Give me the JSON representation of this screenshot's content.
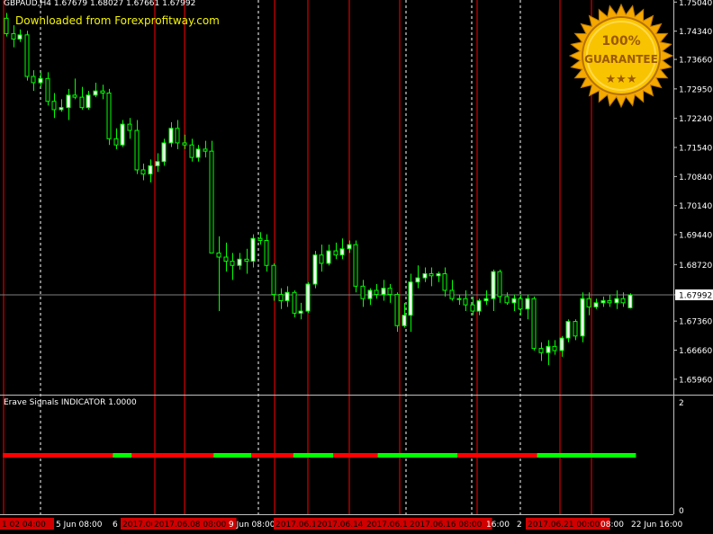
{
  "chart": {
    "symbol_line": "GBPAUD,H4  1.67679 1.68027 1.67661 1.67992",
    "download_text": "Downloaded from Forexprofitway.com",
    "badge_top": "100%",
    "badge_bottom": "GUARANTEE",
    "badge_stars": "★★★",
    "indicator_title": "Erave Signals INDICATOR 1.0000",
    "current_price": "1.67992",
    "colors": {
      "background": "#000000",
      "bull_candle": "#ffffff",
      "bear_candle": "#000000",
      "wick": "#00ff00",
      "session_line": "#ff0000",
      "grid_line": "#ffffff",
      "signal_buy": "#00ff00",
      "signal_sell": "#ff0000",
      "badge_gold": "#f0b000"
    }
  },
  "chart_data": {
    "type": "candlestick",
    "price_axis": {
      "ylim": [
        1.6561,
        1.7509
      ],
      "ticks": [
        "1.75040",
        "1.74340",
        "1.73660",
        "1.72950",
        "1.72240",
        "1.71540",
        "1.70840",
        "1.70140",
        "1.69440",
        "1.68720",
        "1.67992",
        "1.67360",
        "1.66660",
        "1.65960"
      ]
    },
    "indicator_axis": {
      "ylim": [
        0,
        2
      ],
      "ticks": [
        "2",
        "0"
      ]
    },
    "time_labels": [
      {
        "text": "1 02 04:00",
        "highlight": true
      },
      {
        "text": "5 Jun 08:00",
        "highlight": false
      },
      {
        "text": "6",
        "highlight": false
      },
      {
        "text": "2017.06",
        "highlight": true
      },
      {
        "text": "2017.06.08 08:00",
        "highlight": true
      },
      {
        "text": "9 Jun 08:00",
        "highlight": false
      },
      {
        "text": "2017.06.1",
        "highlight": true
      },
      {
        "text": "2017.06.14 0",
        "highlight": true
      },
      {
        "text": "2017.06.1",
        "highlight": true
      },
      {
        "text": "2017.06.16 08:00",
        "highlight": true
      },
      {
        "text": "16:00",
        "highlight": false
      },
      {
        "text": "2",
        "highlight": false
      },
      {
        "text": "2017.06.21 00:00",
        "highlight": true
      },
      {
        "text": "08:00",
        "highlight": false
      },
      {
        "text": "22 Jun 16:00",
        "highlight": false
      }
    ],
    "candles": [
      [
        1.7465,
        1.7478,
        1.7421,
        1.7428
      ],
      [
        1.7428,
        1.7448,
        1.7395,
        1.7415
      ],
      [
        1.7415,
        1.7438,
        1.7408,
        1.7425
      ],
      [
        1.7425,
        1.7435,
        1.7315,
        1.7325
      ],
      [
        1.7325,
        1.734,
        1.729,
        1.731
      ],
      [
        1.731,
        1.7335,
        1.73,
        1.732
      ],
      [
        1.732,
        1.7335,
        1.7255,
        1.7265
      ],
      [
        1.7265,
        1.7285,
        1.7225,
        1.7245
      ],
      [
        1.7245,
        1.727,
        1.724,
        1.725
      ],
      [
        1.725,
        1.7295,
        1.722,
        1.728
      ],
      [
        1.728,
        1.732,
        1.727,
        1.7275
      ],
      [
        1.7275,
        1.73,
        1.7245,
        1.725
      ],
      [
        1.725,
        1.729,
        1.7245,
        1.728
      ],
      [
        1.728,
        1.731,
        1.7275,
        1.729
      ],
      [
        1.729,
        1.7305,
        1.727,
        1.7285
      ],
      [
        1.7285,
        1.7295,
        1.716,
        1.7175
      ],
      [
        1.7175,
        1.72,
        1.715,
        1.716
      ],
      [
        1.716,
        1.722,
        1.7155,
        1.721
      ],
      [
        1.721,
        1.7225,
        1.7175,
        1.7195
      ],
      [
        1.7195,
        1.722,
        1.709,
        1.71
      ],
      [
        1.71,
        1.7115,
        1.7075,
        1.709
      ],
      [
        1.709,
        1.7125,
        1.707,
        1.711
      ],
      [
        1.711,
        1.714,
        1.7095,
        1.712
      ],
      [
        1.712,
        1.7175,
        1.711,
        1.7165
      ],
      [
        1.7165,
        1.7215,
        1.7155,
        1.72
      ],
      [
        1.72,
        1.722,
        1.715,
        1.7165
      ],
      [
        1.7165,
        1.7185,
        1.715,
        1.716
      ],
      [
        1.716,
        1.7175,
        1.712,
        1.713
      ],
      [
        1.713,
        1.716,
        1.712,
        1.715
      ],
      [
        1.715,
        1.717,
        1.713,
        1.7145
      ],
      [
        1.7145,
        1.717,
        1.696,
        1.69
      ],
      [
        1.69,
        1.694,
        1.676,
        1.689
      ],
      [
        1.689,
        1.6925,
        1.6855,
        1.688
      ],
      [
        1.688,
        1.69,
        1.6835,
        1.687
      ],
      [
        1.687,
        1.69,
        1.686,
        1.6885
      ],
      [
        1.6885,
        1.691,
        1.685,
        1.688
      ],
      [
        1.688,
        1.6945,
        1.6865,
        1.6935
      ],
      [
        1.6935,
        1.695,
        1.692,
        1.693
      ],
      [
        1.693,
        1.6945,
        1.6855,
        1.687
      ],
      [
        1.687,
        1.6875,
        1.6785,
        1.68
      ],
      [
        1.68,
        1.6815,
        1.6765,
        1.6785
      ],
      [
        1.6785,
        1.682,
        1.677,
        1.6805
      ],
      [
        1.6805,
        1.681,
        1.6745,
        1.6755
      ],
      [
        1.6755,
        1.678,
        1.674,
        1.676
      ],
      [
        1.676,
        1.683,
        1.6755,
        1.6825
      ],
      [
        1.6825,
        1.6905,
        1.6815,
        1.6895
      ],
      [
        1.6895,
        1.692,
        1.6855,
        1.6875
      ],
      [
        1.6875,
        1.692,
        1.687,
        1.6905
      ],
      [
        1.6905,
        1.6925,
        1.6885,
        1.6895
      ],
      [
        1.6895,
        1.6935,
        1.6885,
        1.691
      ],
      [
        1.691,
        1.693,
        1.69,
        1.692
      ],
      [
        1.692,
        1.693,
        1.6805,
        1.682
      ],
      [
        1.682,
        1.6835,
        1.677,
        1.679
      ],
      [
        1.679,
        1.6815,
        1.6775,
        1.681
      ],
      [
        1.681,
        1.6825,
        1.679,
        1.68
      ],
      [
        1.68,
        1.6835,
        1.6785,
        1.6815
      ],
      [
        1.6815,
        1.6825,
        1.678,
        1.68
      ],
      [
        1.68,
        1.6805,
        1.671,
        1.6725
      ],
      [
        1.6725,
        1.678,
        1.672,
        1.675
      ],
      [
        1.675,
        1.685,
        1.671,
        1.683
      ],
      [
        1.683,
        1.687,
        1.6815,
        1.684
      ],
      [
        1.684,
        1.6865,
        1.683,
        1.685
      ],
      [
        1.685,
        1.6865,
        1.682,
        1.6845
      ],
      [
        1.6845,
        1.6855,
        1.683,
        1.685
      ],
      [
        1.685,
        1.6865,
        1.6795,
        1.681
      ],
      [
        1.681,
        1.6835,
        1.6785,
        1.679
      ],
      [
        1.679,
        1.68,
        1.6775,
        1.679
      ],
      [
        1.679,
        1.681,
        1.676,
        1.6775
      ],
      [
        1.6775,
        1.6795,
        1.675,
        1.676
      ],
      [
        1.676,
        1.679,
        1.675,
        1.6785
      ],
      [
        1.6785,
        1.681,
        1.6775,
        1.679
      ],
      [
        1.679,
        1.686,
        1.676,
        1.6855
      ],
      [
        1.6855,
        1.686,
        1.678,
        1.6795
      ],
      [
        1.6795,
        1.6805,
        1.6775,
        1.678
      ],
      [
        1.678,
        1.68,
        1.676,
        1.679
      ],
      [
        1.679,
        1.68,
        1.675,
        1.6765
      ],
      [
        1.6765,
        1.68,
        1.674,
        1.679
      ],
      [
        1.679,
        1.6795,
        1.6665,
        1.667
      ],
      [
        1.667,
        1.6685,
        1.664,
        1.666
      ],
      [
        1.666,
        1.669,
        1.663,
        1.6675
      ],
      [
        1.6675,
        1.669,
        1.6655,
        1.6665
      ],
      [
        1.6665,
        1.67,
        1.665,
        1.6695
      ],
      [
        1.6695,
        1.674,
        1.6685,
        1.6735
      ],
      [
        1.6735,
        1.674,
        1.669,
        1.67
      ],
      [
        1.67,
        1.6805,
        1.6685,
        1.679
      ],
      [
        1.679,
        1.6805,
        1.675,
        1.677
      ],
      [
        1.677,
        1.679,
        1.6765,
        1.678
      ],
      [
        1.678,
        1.6795,
        1.677,
        1.6785
      ],
      [
        1.6785,
        1.68,
        1.677,
        1.678
      ],
      [
        1.678,
        1.681,
        1.6765,
        1.679
      ],
      [
        1.679,
        1.6805,
        1.677,
        1.678
      ],
      [
        1.6768,
        1.6803,
        1.6766,
        1.6799
      ]
    ],
    "signals": "RRRRRRRRRRRRRRRRRRRRRRRRRRRRRRRRRRRRRRRRRRRRRRRGGGGGGGGRRRRRRRRRRRRRRRRRRRRRRRRRRRRRRRRRRRGGGGGGGGGGGGGGGGRRRRRRRRRRRRRRRRRRGGGGGGGGGGGGGGGGGRRRRRRRRRRRRRRRRRRRGGGGGGGGGGGGGGGGGGGGGGGGGGGGGGGGGGRRRRRRRRRRRRRRRRRRRRRRRRRRRRRRRRRRGGGGGGGGGGGGGGGGGGGGGGGGGGGGGGGGGGGGGGGGGG",
    "grid": true
  }
}
